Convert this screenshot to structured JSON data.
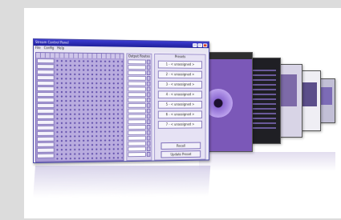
{
  "window": {
    "title": "Stream Control Panel",
    "menu": [
      "File",
      "Config",
      "Help"
    ],
    "close_icon": "close-icon"
  },
  "outputs": {
    "title": "Output Routes"
  },
  "presets": {
    "title": "Presets",
    "buttons": [
      "1 - < unassigned >",
      "2 - < unassigned >",
      "3 - < unassigned >",
      "4 - < unassigned >",
      "5 - < unassigned >",
      "6 - < unassigned >",
      "7 - < unassigned >"
    ],
    "recall_label": "Recall",
    "update_label": "Update Preset"
  },
  "colors": {
    "accent": "#a99ad6",
    "titlebar": "#1f1f9a"
  }
}
